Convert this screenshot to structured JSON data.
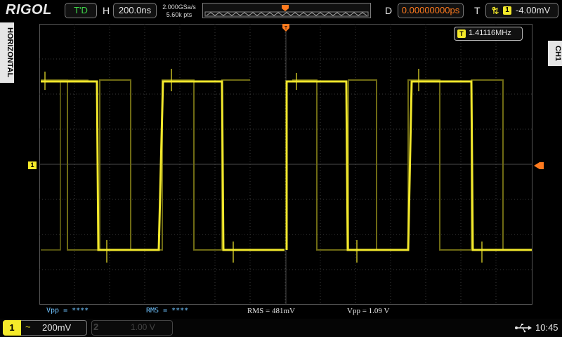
{
  "brand": "RIGOL",
  "top": {
    "run_status": "T'D",
    "horizontal_label": "H",
    "timebase": "200.0ns",
    "sample_rate": "2.000GSa/s",
    "memory_depth": "5.60k pts",
    "delay_label": "D",
    "delay_value": "0.00000000ps",
    "trigger_label": "T",
    "trigger_source": "1",
    "trigger_level": "-4.00mV"
  },
  "side": {
    "left_tab": "HORIZONTAL",
    "right_tab": "CH1"
  },
  "frequency_counter": {
    "badge": "T",
    "value": "1.41116MHz"
  },
  "markers": {
    "ch1_ground": "1",
    "trigger_time": "T"
  },
  "measurements": [
    {
      "label": "Vpp = ****"
    },
    {
      "label": "RMS = ****"
    },
    {
      "label": "RMS = 481mV"
    },
    {
      "label": "Vpp = 1.09 V"
    }
  ],
  "bottom": {
    "ch1_number": "1",
    "ch1_coupling": "~",
    "ch1_scale": "200mV",
    "ch2_number": "2",
    "ch2_scale": "1.00 V",
    "clock": "10:45"
  },
  "colors": {
    "trace": "#f2e82c",
    "trace_dim": "#6e6a14",
    "grid": "#3a3a3a",
    "accent_orange": "#ff7a1e",
    "measure_blue": "#6fc3ff"
  }
}
